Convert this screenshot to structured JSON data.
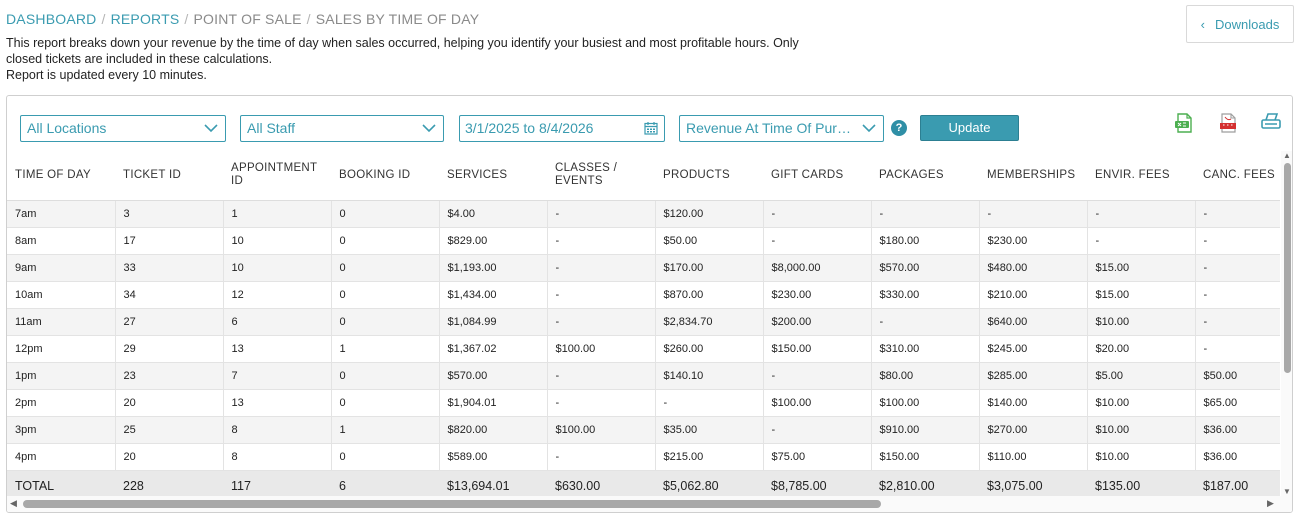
{
  "breadcrumb": {
    "items": [
      "DASHBOARD",
      "REPORTS",
      "POINT OF SALE",
      "SALES BY TIME OF DAY"
    ],
    "separator": "/"
  },
  "description": {
    "line1": "This report breaks down your revenue by the time of day when sales occurred, helping you identify your busiest and most profitable hours. Only closed tickets are included in these calculations.",
    "line2": "Report is updated every 10 minutes."
  },
  "downloads_button": {
    "label": "Downloads",
    "icon": "chevron-left-icon"
  },
  "filters": {
    "location": "All Locations",
    "staff": "All Staff",
    "date_range": "3/1/2025 to 8/4/2026",
    "revenue_mode": "Revenue At Time Of Purc...",
    "help": "?",
    "update_label": "Update"
  },
  "toolbar_icons": [
    "csv-export-icon",
    "pdf-export-icon",
    "print-icon"
  ],
  "colors": {
    "accent": "#3a9bb0",
    "total_row": "#e9e9e9",
    "csv_icon": "#4caf50",
    "pdf_icon": "#d32f2f"
  },
  "table": {
    "headers": [
      "TIME OF DAY",
      "TICKET ID",
      "APPOINTMENT ID",
      "BOOKING ID",
      "SERVICES",
      "CLASSES / EVENTS",
      "PRODUCTS",
      "GIFT CARDS",
      "PACKAGES",
      "MEMBERSHIPS",
      "ENVIR. FEES",
      "CANC. FEES"
    ],
    "rows": [
      [
        "7am",
        "3",
        "1",
        "0",
        "$4.00",
        "-",
        "$120.00",
        "-",
        "-",
        "-",
        "-",
        "-"
      ],
      [
        "8am",
        "17",
        "10",
        "0",
        "$829.00",
        "-",
        "$50.00",
        "-",
        "$180.00",
        "$230.00",
        "-",
        "-"
      ],
      [
        "9am",
        "33",
        "10",
        "0",
        "$1,193.00",
        "-",
        "$170.00",
        "$8,000.00",
        "$570.00",
        "$480.00",
        "$15.00",
        "-"
      ],
      [
        "10am",
        "34",
        "12",
        "0",
        "$1,434.00",
        "-",
        "$870.00",
        "$230.00",
        "$330.00",
        "$210.00",
        "$15.00",
        "-"
      ],
      [
        "11am",
        "27",
        "6",
        "0",
        "$1,084.99",
        "-",
        "$2,834.70",
        "$200.00",
        "-",
        "$640.00",
        "$10.00",
        "-"
      ],
      [
        "12pm",
        "29",
        "13",
        "1",
        "$1,367.02",
        "$100.00",
        "$260.00",
        "$150.00",
        "$310.00",
        "$245.00",
        "$20.00",
        "-"
      ],
      [
        "1pm",
        "23",
        "7",
        "0",
        "$570.00",
        "-",
        "$140.10",
        "-",
        "$80.00",
        "$285.00",
        "$5.00",
        "$50.00"
      ],
      [
        "2pm",
        "20",
        "13",
        "0",
        "$1,904.01",
        "-",
        "-",
        "$100.00",
        "$100.00",
        "$140.00",
        "$10.00",
        "$65.00"
      ],
      [
        "3pm",
        "25",
        "8",
        "1",
        "$820.00",
        "$100.00",
        "$35.00",
        "-",
        "$910.00",
        "$270.00",
        "$10.00",
        "$36.00"
      ],
      [
        "4pm",
        "20",
        "8",
        "0",
        "$589.00",
        "-",
        "$215.00",
        "$75.00",
        "$150.00",
        "$110.00",
        "$10.00",
        "$36.00"
      ]
    ],
    "total": [
      "TOTAL",
      "228",
      "117",
      "6",
      "$13,694.01",
      "$630.00",
      "$5,062.80",
      "$8,785.00",
      "$2,810.00",
      "$3,075.00",
      "$135.00",
      "$187.00"
    ]
  }
}
